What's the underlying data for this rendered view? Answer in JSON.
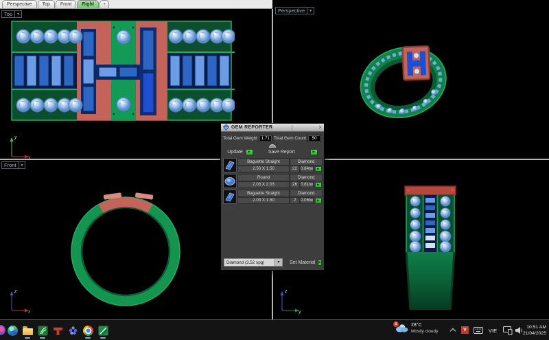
{
  "tabs": {
    "items": [
      {
        "label": "Perspective",
        "active": false
      },
      {
        "label": "Top",
        "active": false
      },
      {
        "label": "Front",
        "active": false
      },
      {
        "label": "Right",
        "active": true
      }
    ],
    "new_tab_label": "+"
  },
  "viewports": {
    "top": {
      "label": "Top",
      "axis_vertical": "y",
      "axis_horizontal": "x"
    },
    "perspective": {
      "label": "Perspective"
    },
    "front": {
      "label": "Front",
      "axis_vertical": "z",
      "axis_horizontal": "x"
    },
    "right": {
      "axis_vertical": "z",
      "axis_horizontal": "y"
    }
  },
  "dialog": {
    "title": "GEM REPORTER",
    "total_gem_weight_label": "Total Gem Weight",
    "total_gem_weight_value": "1.71",
    "total_gem_count_label": "Total Gem Count",
    "total_gem_count_value": "50",
    "update_label": "Update",
    "save_report_label": "Save Report",
    "rows": [
      {
        "icon": "baguette-gem-icon",
        "shape": "Baguette Straight",
        "material": "Diamond",
        "size": "2.50 X 1.50",
        "count": "22",
        "weight": "0.84tw"
      },
      {
        "icon": "round-gem-icon",
        "shape": "Round",
        "material": "Diamond",
        "size": "2.03 X 2.03",
        "count": "26",
        "weight": "0.81tw"
      },
      {
        "icon": "baguette-gem-icon",
        "shape": "Baguette Straight",
        "material": "Diamond",
        "size": "2.00 X 1.50",
        "count": "2",
        "weight": "0.06tw"
      }
    ],
    "material_dropdown_value": "Diamond    (3.52 spg)",
    "set_material_label": "Set Material"
  },
  "taskbar": {
    "app_icons": [
      "edge",
      "file-explorer",
      "green-plant-app",
      "red-blocks-app",
      "dots-app",
      "chrome",
      "green-striped-app"
    ],
    "weather": {
      "badge": "1",
      "temperature": "28°C",
      "condition": "Mostly cloudy"
    },
    "tray": {
      "v_badge": "V",
      "language": "VIE"
    },
    "clock": {
      "time": "10:51 AM",
      "date": "21/04/2025"
    }
  },
  "colors": {
    "rail_green": "#0b4f2e",
    "band_green": "#149a57",
    "edge_green": "#1fae63",
    "plaque_red": "#c4635a",
    "cap_red": "#b5473c",
    "navy": "#0a2a6b",
    "gem_blue": "#2e66c4",
    "gem_blue_light": "#6d9ce6",
    "gem_pale": "#cfe2f8",
    "accent_green": "#3fae3f",
    "tab_active_green": "#7cc47c",
    "divider_gray": "#b4b4b4"
  }
}
